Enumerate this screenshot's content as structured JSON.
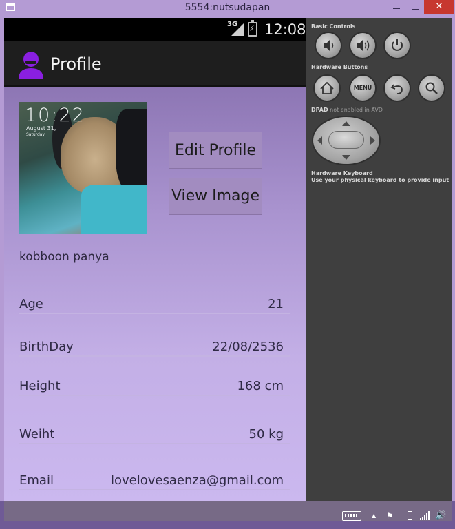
{
  "window": {
    "title": "5554:nutsudapan",
    "close_glyph": "✕"
  },
  "status_bar": {
    "network": "3G",
    "time": "12:08"
  },
  "action_bar": {
    "title": "Profile"
  },
  "profile": {
    "photo": {
      "clock": "10:22",
      "date": "August 31,",
      "day": "Saturday"
    },
    "buttons": {
      "edit": "Edit Profile",
      "view": "View Image"
    },
    "name": "kobboon panya",
    "fields": [
      {
        "label": "Age",
        "value": "21"
      },
      {
        "label": "BirthDay",
        "value": "22/08/2536"
      },
      {
        "label": "Height",
        "value": "168 cm"
      },
      {
        "label": "Weiht",
        "value": "50 kg"
      },
      {
        "label": "Email",
        "value": "lovelovesaenza@gmail.com"
      }
    ]
  },
  "controls": {
    "basic_title": "Basic Controls",
    "hardware_title": "Hardware Buttons",
    "menu_label": "MENU",
    "dpad_prefix": "DPAD",
    "dpad_note": " not enabled in AVD",
    "keyboard_title": "Hardware Keyboard",
    "keyboard_note": "Use your physical keyboard to provide input"
  },
  "icons": {
    "volume_down": "volume-down-icon",
    "volume_up": "volume-up-icon",
    "power": "power-icon",
    "home": "home-icon",
    "back": "back-icon",
    "search": "search-icon"
  },
  "colors": {
    "content_top": "#8d76b4",
    "content_bottom": "#cbb8ef",
    "avatar_purple": "#8a1fe0"
  }
}
